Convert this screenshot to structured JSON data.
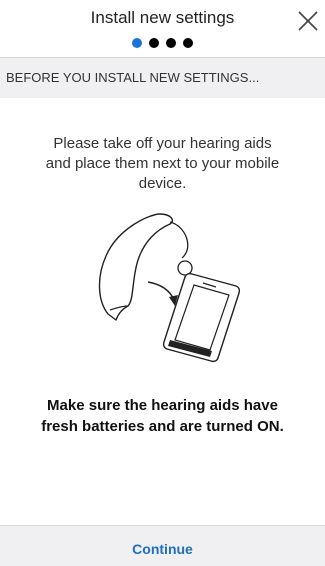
{
  "header": {
    "title": "Install new settings",
    "steps": {
      "total": 4,
      "current": 1
    },
    "close_icon": "close-icon"
  },
  "subheader": {
    "text": "BEFORE YOU INSTALL NEW SETTINGS..."
  },
  "main": {
    "instruction": "Please take off your hearing aids and place them next to your mobile device.",
    "illustration_icon": "hearing-aid-and-phone-illustration",
    "note": "Make sure the hearing aids have fresh batteries and are turned ON."
  },
  "footer": {
    "continue_label": "Continue"
  },
  "colors": {
    "accent": "#1a73d9",
    "link": "#1a6fc4",
    "subheader_bg": "#f0f0f2"
  }
}
